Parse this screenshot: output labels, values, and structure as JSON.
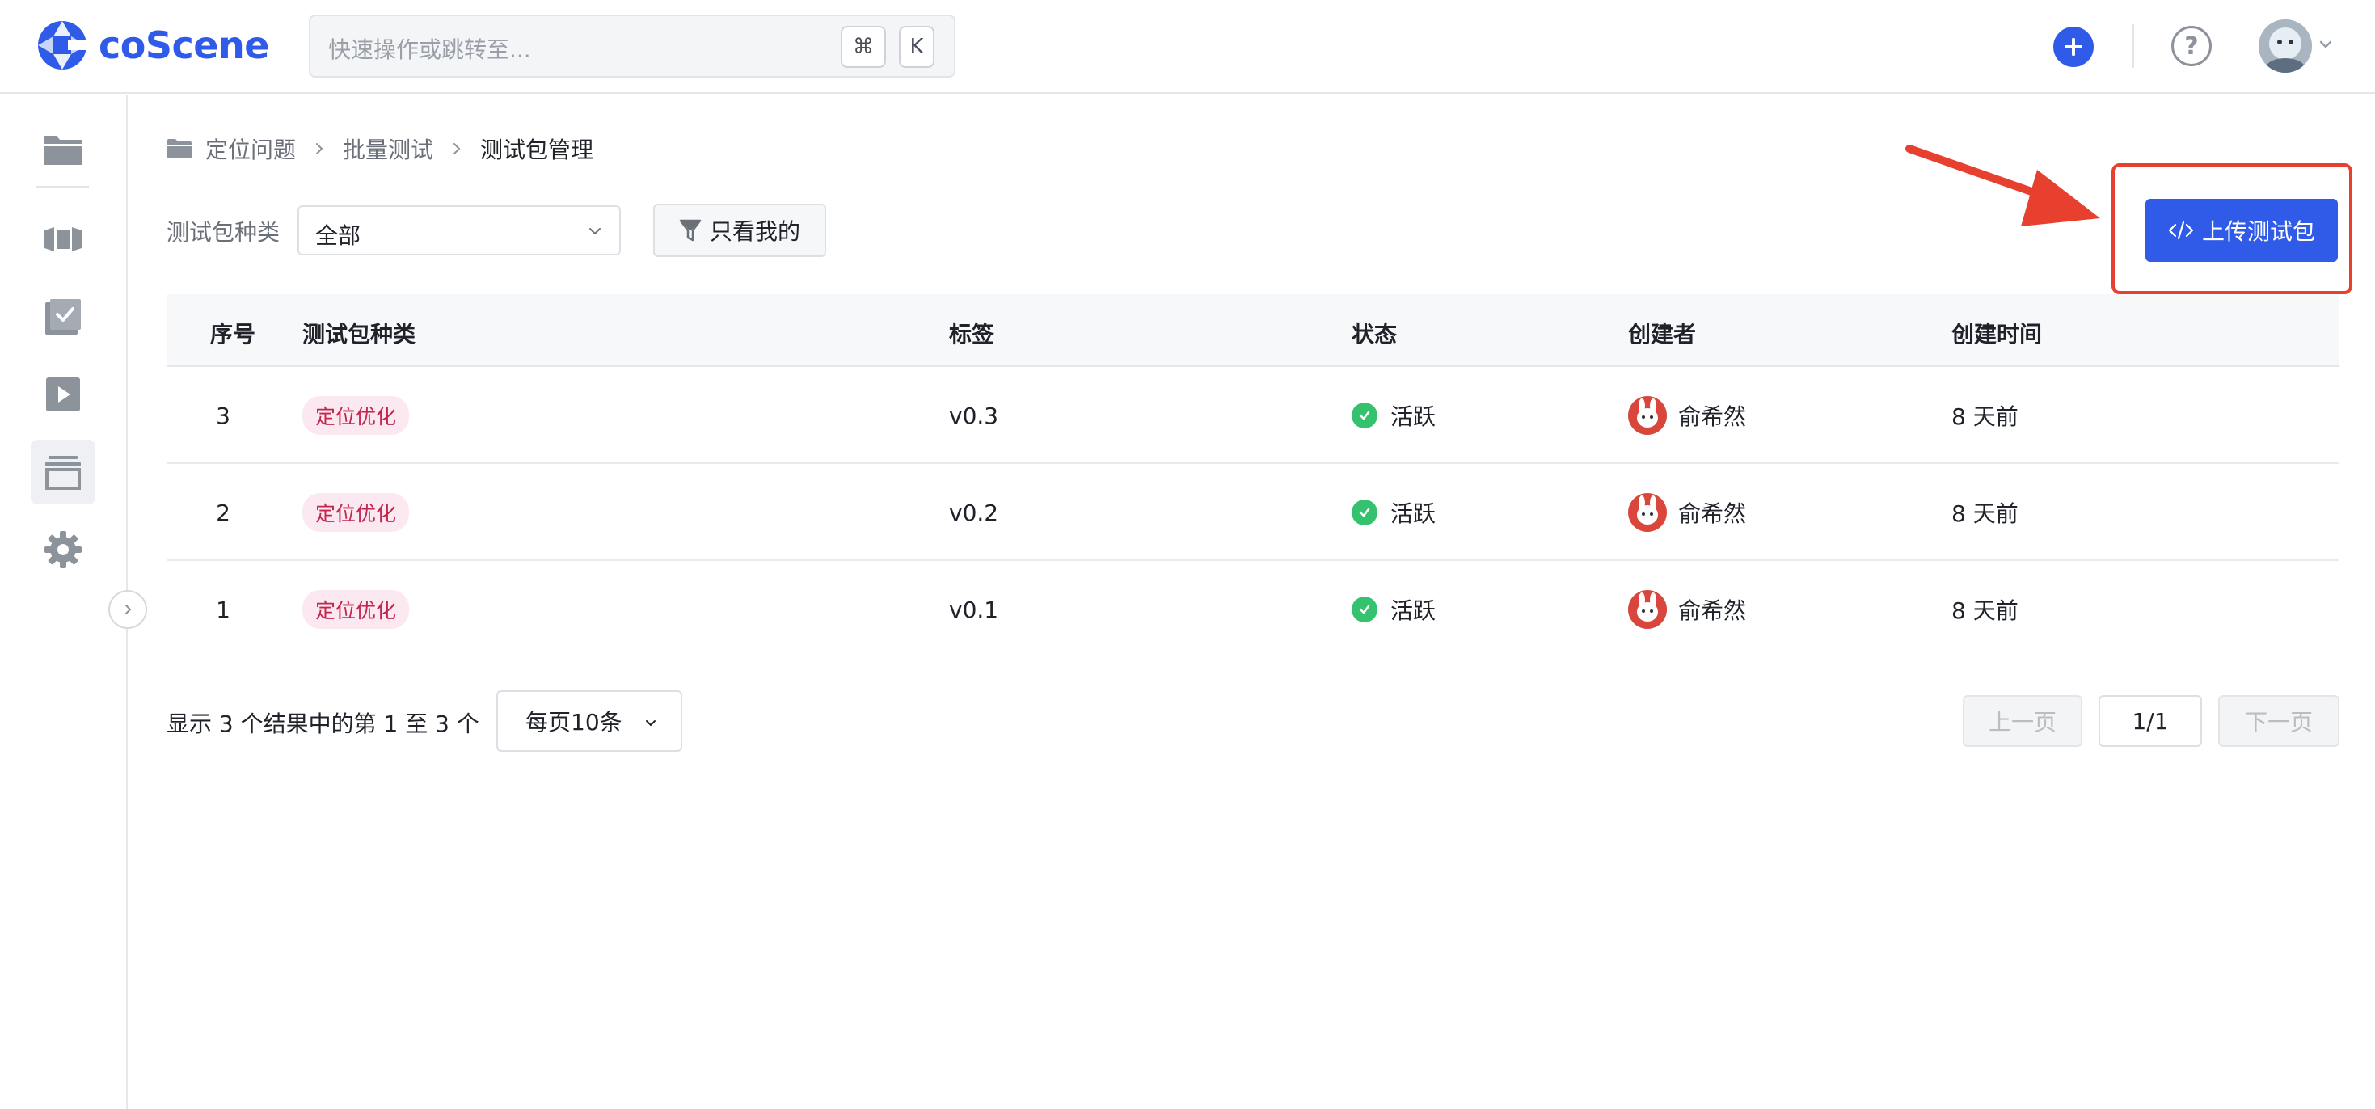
{
  "app": {
    "name": "coScene"
  },
  "header": {
    "search_placeholder": "快速操作或跳转至...",
    "shortcut_cmd": "⌘",
    "shortcut_key": "K",
    "help_label": "?"
  },
  "sidebar": {
    "items": [
      {
        "icon": "folder-icon",
        "active": false
      },
      {
        "icon": "record-icon",
        "active": false
      },
      {
        "icon": "task-check-icon",
        "active": false
      },
      {
        "icon": "play-icon",
        "active": false
      },
      {
        "icon": "package-icon",
        "active": true
      },
      {
        "icon": "gear-icon",
        "active": false
      }
    ]
  },
  "breadcrumb": {
    "items": [
      "定位问题",
      "批量测试",
      "测试包管理"
    ]
  },
  "filters": {
    "type_label": "测试包种类",
    "type_value": "全部",
    "mine_label": "只看我的"
  },
  "actions": {
    "upload_label": "上传测试包"
  },
  "table": {
    "columns": [
      "序号",
      "测试包种类",
      "标签",
      "状态",
      "创建者",
      "创建时间"
    ],
    "rows": [
      {
        "index": "3",
        "type": "定位优化",
        "tag": "v0.3",
        "status": "活跃",
        "creator": "俞希然",
        "created": "8 天前"
      },
      {
        "index": "2",
        "type": "定位优化",
        "tag": "v0.2",
        "status": "活跃",
        "creator": "俞希然",
        "created": "8 天前"
      },
      {
        "index": "1",
        "type": "定位优化",
        "tag": "v0.1",
        "status": "活跃",
        "creator": "俞希然",
        "created": "8 天前"
      }
    ]
  },
  "pagination": {
    "summary": "显示 3 个结果中的第 1 至 3 个",
    "page_size": "每页10条",
    "prev": "上一页",
    "page": "1/1",
    "next": "下一页"
  },
  "colors": {
    "primary": "#2f5be8",
    "highlight": "#e8402e",
    "tag_bg": "#fce8f0",
    "tag_text": "#c0264e",
    "status_active": "#34c26e"
  }
}
